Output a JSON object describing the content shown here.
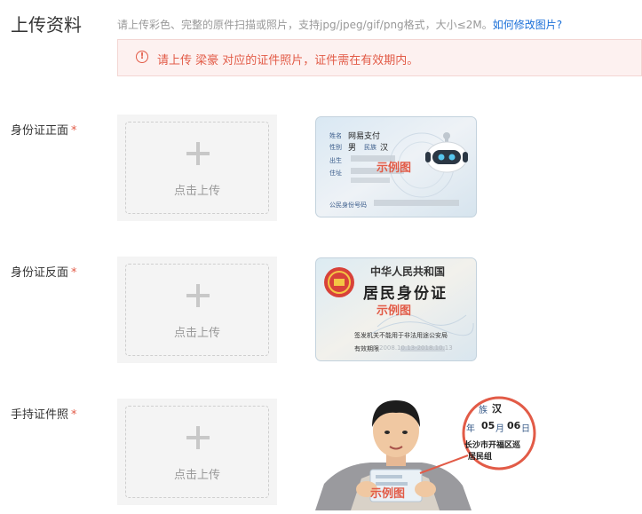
{
  "header": {
    "title": "上传资料",
    "hint": "请上传彩色、完整的原件扫描或照片，支持jpg/jpeg/gif/png格式，大小≤2M。",
    "link": "如何修改图片?"
  },
  "alert": {
    "icon": "info-icon",
    "text": "请上传 梁豪 对应的证件照片，证件需在有效期内。"
  },
  "rows": [
    {
      "label": "身份证正面",
      "required_mark": "*",
      "upload_text": "点击上传",
      "sample_label": "示例图"
    },
    {
      "label": "身份证反面",
      "required_mark": "*",
      "upload_text": "点击上传",
      "sample_label": "示例图"
    },
    {
      "label": "手持证件照",
      "required_mark": "*",
      "upload_text": "点击上传",
      "sample_label": "示例图"
    }
  ],
  "front_card": {
    "name_label": "姓名",
    "name_value": "网易支付",
    "sex_label": "性别",
    "sex_value": "男",
    "ethnic_label": "民族",
    "ethnic_value": "汉",
    "birth_label": "出生",
    "address_label": "住址",
    "id_label": "公民身份号码"
  },
  "back_card": {
    "country": "中华人民共和国",
    "title": "居民身份证",
    "authority_label": "签发机关",
    "authority_value": "不能用于非法用途公安局",
    "valid_label": "有效期限",
    "valid_value": "2008.10.13-2018.10.13"
  },
  "handheld_zoom": {
    "ethnic_label": "族",
    "ethnic_value": "汉",
    "year_label": "年",
    "month_value": "05",
    "month_label": "月",
    "day_value": "06",
    "day_label": "日",
    "address_line1": "长沙市开福区巡",
    "address_line2": "居民组"
  },
  "colors": {
    "accent_red": "#e25b47",
    "link_blue": "#1a6fd8",
    "alert_bg": "#fdf1f0"
  }
}
